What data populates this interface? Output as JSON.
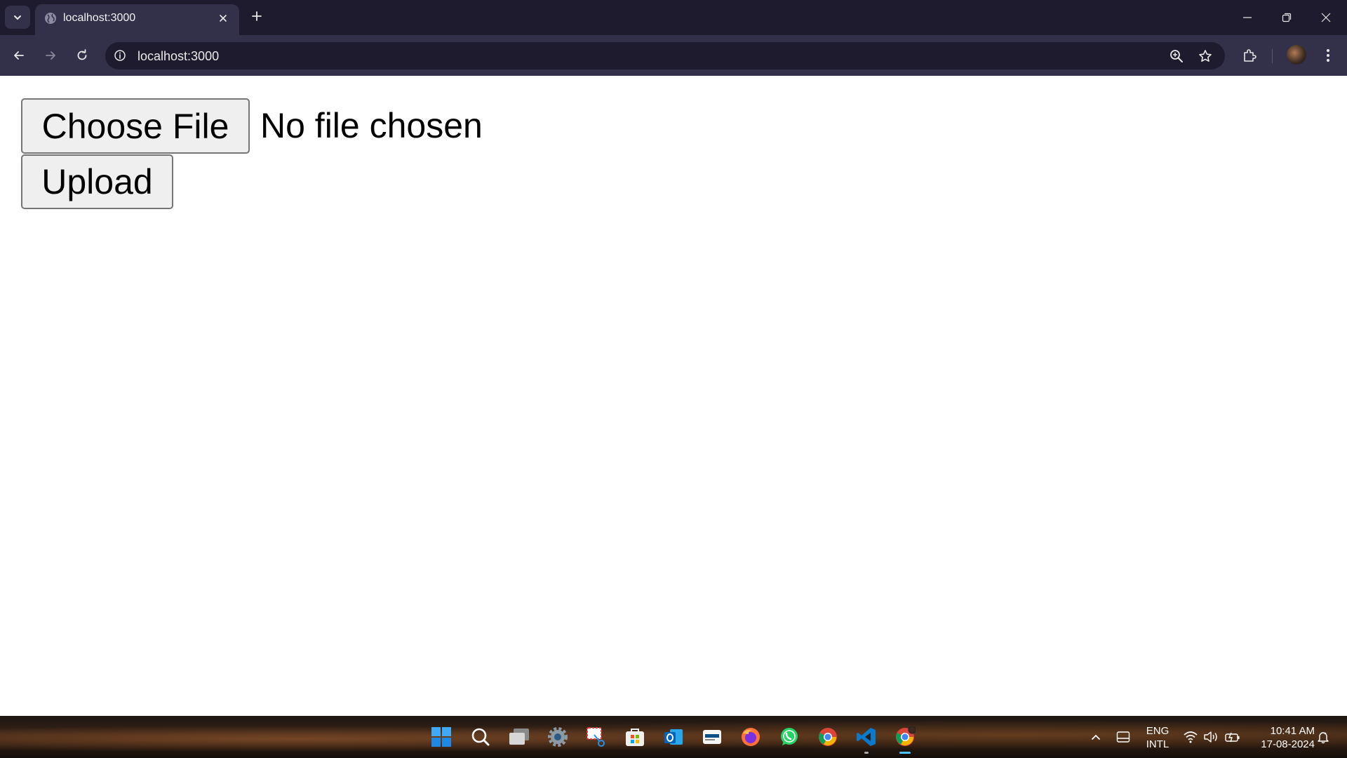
{
  "browser": {
    "tab": {
      "title": "localhost:3000"
    },
    "url": "localhost:3000"
  },
  "page": {
    "choose_file_label": "Choose File",
    "file_status": "No file chosen",
    "upload_label": "Upload"
  },
  "taskbar": {
    "language": {
      "line1": "ENG",
      "line2": "INTL"
    },
    "clock": {
      "time": "10:41 AM",
      "date": "17-08-2024"
    },
    "apps": [
      "start-icon",
      "search-icon",
      "task-view-icon",
      "settings-icon",
      "snipping-tool-icon",
      "microsoft-store-icon",
      "outlook-icon",
      "news-icon",
      "firefox-icon",
      "whatsapp-icon",
      "chrome-icon",
      "vscode-icon",
      "chrome-profile-icon"
    ]
  },
  "colors": {
    "tabstrip_bg": "#1e1b2e",
    "toolbar_bg": "#33304a",
    "button_bg": "#efefef",
    "button_border": "#767676",
    "taskbar_active": "#4cc2ff"
  }
}
